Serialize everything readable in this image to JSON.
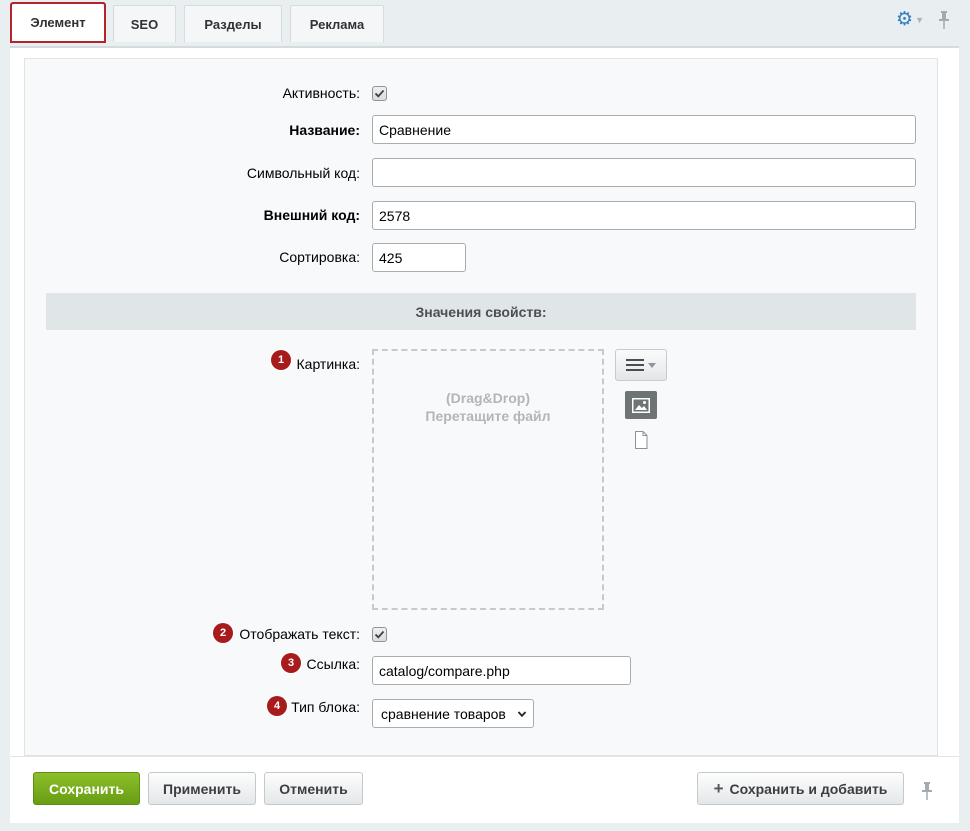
{
  "tabs": [
    {
      "label": "Элемент"
    },
    {
      "label": "SEO"
    },
    {
      "label": "Разделы"
    },
    {
      "label": "Реклама"
    }
  ],
  "tab_icons": {
    "settings": "gear-icon",
    "pin": "pin-icon"
  },
  "form": {
    "active_label": "Активность:",
    "active_checked": true,
    "name_label": "Название:",
    "name_value": "Сравнение",
    "code_label": "Символьный код:",
    "code_value": "",
    "ext_code_label": "Внешний код:",
    "ext_code_value": "2578",
    "sort_label": "Сортировка:",
    "sort_value": "425"
  },
  "properties": {
    "header": "Значения свойств:",
    "picture": {
      "badge": "1",
      "label": "Картинка:",
      "drop_line1": "(Drag&Drop)",
      "drop_line2": "Перетащите файл"
    },
    "show_text": {
      "badge": "2",
      "label": "Отображать текст:",
      "checked": true
    },
    "link": {
      "badge": "3",
      "label": "Ссылка:",
      "value": "catalog/compare.php"
    },
    "block_type": {
      "badge": "4",
      "label": "Тип блока:",
      "value": "сравнение товаров"
    }
  },
  "footer": {
    "save": "Сохранить",
    "apply": "Применить",
    "cancel": "Отменить",
    "save_add": "Сохранить и добавить"
  },
  "colors": {
    "accent_green": "#7aae1f",
    "badge_red": "#a71b1c",
    "active_tab_outline": "#b3232a",
    "gear_blue": "#2f7fbf"
  }
}
